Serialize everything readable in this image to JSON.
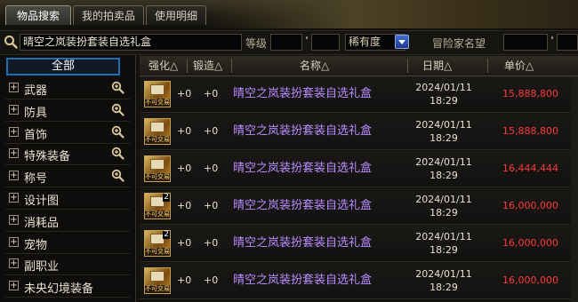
{
  "tabs": [
    {
      "label": "物品搜索",
      "active": true
    },
    {
      "label": "我的拍卖品",
      "active": false
    },
    {
      "label": "使用明细",
      "active": false
    }
  ],
  "search": {
    "query": "晴空之岚装扮套装自选礼盒",
    "level_label": "等级",
    "level_min": "",
    "level_max": "",
    "rarity_value": "稀有度",
    "adventurer_label": "冒险家名望",
    "adventurer_value": ""
  },
  "sidebar": {
    "all_label": "全部",
    "items": [
      {
        "label": "武器",
        "has_zoom": true
      },
      {
        "label": "防具",
        "has_zoom": true
      },
      {
        "label": "首饰",
        "has_zoom": true
      },
      {
        "label": "特殊装备",
        "has_zoom": true
      },
      {
        "label": "称号",
        "has_zoom": true
      },
      {
        "label": "设计图",
        "has_zoom": false
      },
      {
        "label": "消耗品",
        "has_zoom": false
      },
      {
        "label": "宠物",
        "has_zoom": false
      },
      {
        "label": "副职业",
        "has_zoom": false
      },
      {
        "label": "未央幻境装备",
        "has_zoom": false
      }
    ]
  },
  "table": {
    "headers": {
      "enhance": "强化△",
      "forge": "锻造△",
      "name": "名称△",
      "date": "日期△",
      "price": "单价△"
    },
    "rows": [
      {
        "count": "",
        "tag": "不可交易",
        "enhance": "+0",
        "forge": "+0",
        "name": "晴空之岚装扮套装自选礼盒",
        "date": "2024/01/11",
        "time": "18:29",
        "price": "15,888,800"
      },
      {
        "count": "",
        "tag": "不可交易",
        "enhance": "+0",
        "forge": "+0",
        "name": "晴空之岚装扮套装自选礼盒",
        "date": "2024/01/11",
        "time": "18:29",
        "price": "15,888,800"
      },
      {
        "count": "",
        "tag": "不可交易",
        "enhance": "+0",
        "forge": "+0",
        "name": "晴空之岚装扮套装自选礼盒",
        "date": "2024/01/11",
        "time": "18:29",
        "price": "16,444,444"
      },
      {
        "count": "2",
        "tag": "不可交易",
        "enhance": "+0",
        "forge": "+0",
        "name": "晴空之岚装扮套装自选礼盒",
        "date": "2024/01/11",
        "time": "18:29",
        "price": "16,000,000"
      },
      {
        "count": "2",
        "tag": "不可交易",
        "enhance": "+0",
        "forge": "+0",
        "name": "晴空之岚装扮套装自选礼盒",
        "date": "2024/01/11",
        "time": "18:29",
        "price": "16,000,000"
      },
      {
        "count": "",
        "tag": "不可交易",
        "enhance": "+0",
        "forge": "+0",
        "name": "晴空之岚装扮套装自选礼盒",
        "date": "2024/01/11",
        "time": "18:29",
        "price": "16,000,000"
      }
    ]
  },
  "colors": {
    "item_name": "#b98cff",
    "price": "#ff3a3a",
    "selected_border": "#1f6fb0"
  }
}
